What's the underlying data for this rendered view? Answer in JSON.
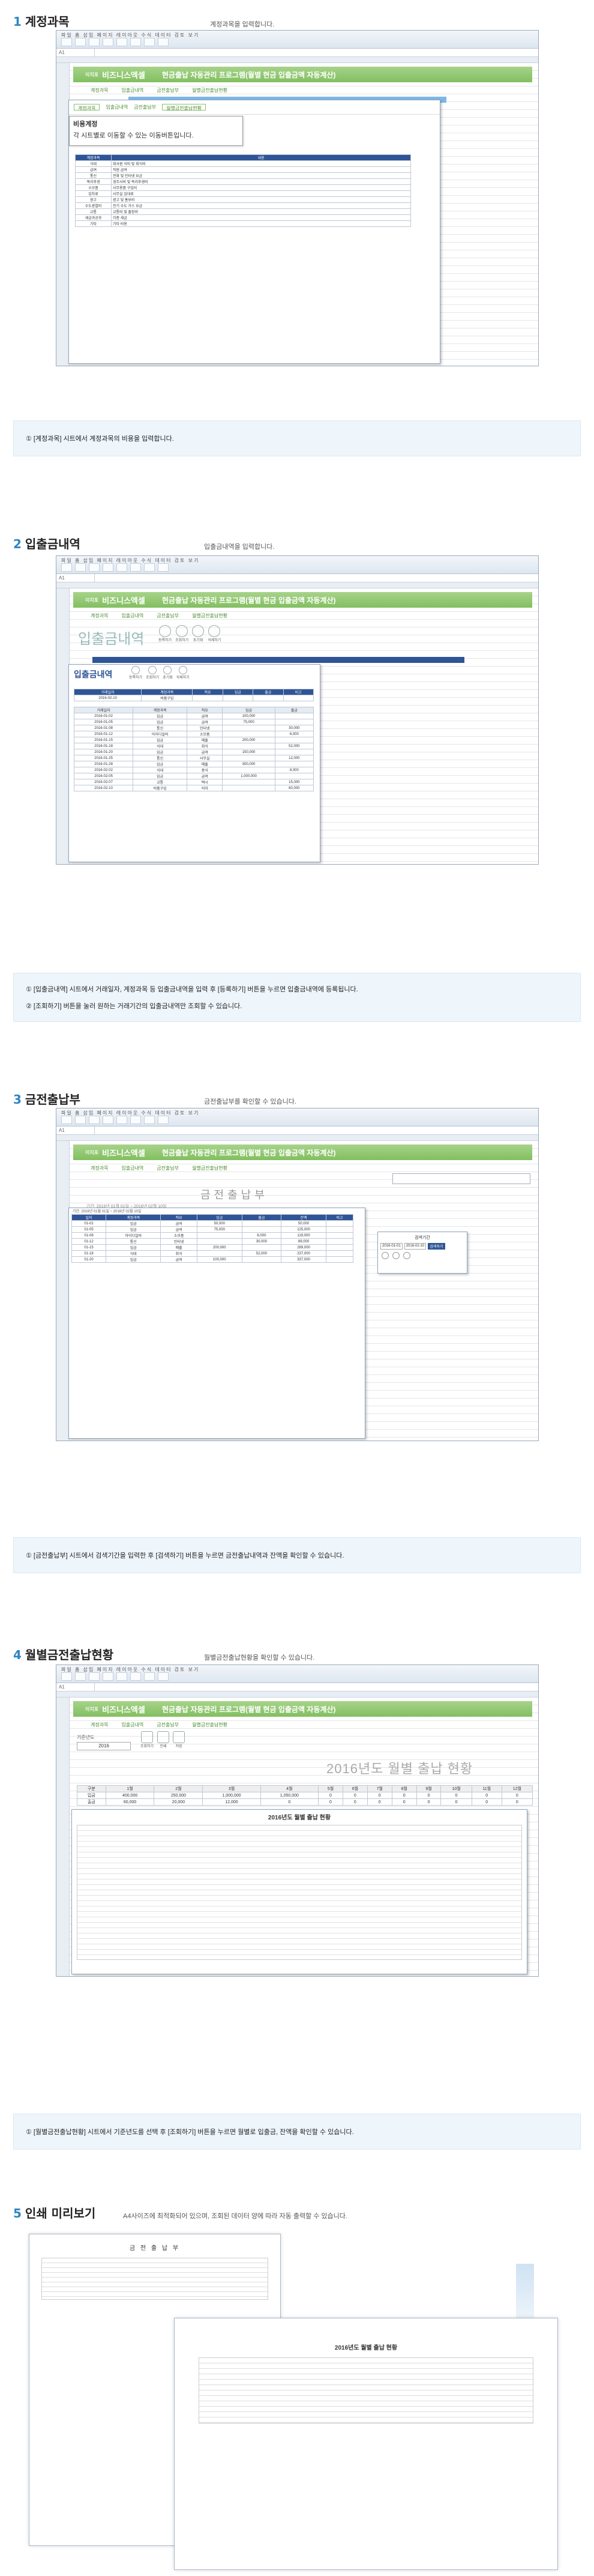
{
  "sections": [
    {
      "num": "1",
      "title": "계정과목",
      "caption": "계정과목을 입력합니다.",
      "note": [
        "① [계정과목] 시트에서 계정과목의 비용을 입력합니다."
      ]
    },
    {
      "num": "2",
      "title": "입출금내역",
      "caption": "입출금내역을 입력합니다.",
      "note": [
        "① [입출금내역] 시트에서 거래일자, 계정과목 등 입출금내역을 입력 후 [등록하기] 버튼을 누르면 입출금내역에 등록됩니다.",
        "② [조회하기] 버튼을 눌러 원하는 거래기간의 입출금내역만 조회할 수 있습니다."
      ]
    },
    {
      "num": "3",
      "title": "금전출납부",
      "caption": "금전출납부를 확인할 수 있습니다.",
      "note": [
        "① [금전출납부] 시트에서 검색기간을 입력한 후 [검색하기] 버튼을 누르면 금전출납내역과 잔액을 확인할 수 있습니다."
      ]
    },
    {
      "num": "4",
      "title": "월별금전출납현황",
      "caption": "월별금전출납현황을 확인할 수 있습니다.",
      "note": [
        "① [월별금전출납현황] 시트에서 기준년도를 선택 후 [조회하기] 버튼을 누르면 월별로 입출금, 잔액을 확인할 수 있습니다."
      ]
    },
    {
      "num": "5",
      "title": "인쇄 미리보기",
      "caption": "A4사이즈에 최적화되어 있으며, 조회된 데이터 양에 따라 자동 출력할 수 있습니다."
    }
  ],
  "app": {
    "logo": "이지포",
    "brand": "비즈니스엑셀",
    "title": "현금출납 자동관리 프로그램(월별 현금 입출금액 자동계산)",
    "cell_ref": "A1",
    "nav": [
      "계정과목",
      "입출금내역",
      "금전출납부",
      "월별금전출납현황"
    ]
  },
  "s1": {
    "popup_title": "비용계정",
    "popup_desc": "각 시트별로 이동할 수 있는 이동버튼입니다.",
    "table_head": [
      "계정과목",
      "내용"
    ],
    "rows": [
      [
        "식대",
        "회사원 식비 및 회식비"
      ],
      [
        "급여",
        "직원 급여"
      ],
      [
        "통신",
        "전화 및 인터넷 요금"
      ],
      [
        "복리후생",
        "경조사비 및 복리후생비"
      ],
      [
        "소모품",
        "사무용품 구입비"
      ],
      [
        "임차료",
        "사무실 임대료"
      ],
      [
        "광고",
        "광고 및 홍보비"
      ],
      [
        "수도광열비",
        "전기 수도 가스 요금"
      ],
      [
        "교통",
        "교통비 및 출장비"
      ],
      [
        "세금과공과",
        "각종 세금"
      ],
      [
        "기타",
        "기타 비용"
      ]
    ]
  },
  "s2": {
    "heading": "입출금내역",
    "buttons": [
      "등록하기",
      "조회하기",
      "초기화",
      "삭제하기"
    ],
    "col_head": [
      "거래일자",
      "계정과목",
      "적요",
      "입금",
      "출금",
      "비고"
    ],
    "input_date": "2016-02-10",
    "input_account": "비품구입",
    "rows": [
      [
        "2016-01-02",
        "입금",
        "급여",
        "100,000",
        ""
      ],
      [
        "2016-01-05",
        "입금",
        "급여",
        "75,000",
        ""
      ],
      [
        "2016-01-08",
        "통신",
        "인터넷",
        "",
        "30,000"
      ],
      [
        "2016-01-12",
        "아이디얼비",
        "소모품",
        "",
        "6,000"
      ],
      [
        "2016-01-15",
        "입금",
        "매출",
        "200,000",
        ""
      ],
      [
        "2016-01-18",
        "식대",
        "회식",
        "",
        "52,000"
      ],
      [
        "2016-01-20",
        "입금",
        "급여",
        "150,000",
        ""
      ],
      [
        "2016-01-25",
        "통신",
        "사무실",
        "",
        "12,000"
      ],
      [
        "2016-01-28",
        "입금",
        "매출",
        "300,000",
        ""
      ],
      [
        "2016-02-02",
        "식대",
        "중식",
        "",
        "8,000"
      ],
      [
        "2016-02-05",
        "입금",
        "급여",
        "1,000,000",
        ""
      ],
      [
        "2016-02-07",
        "교통",
        "택시",
        "",
        "15,000"
      ],
      [
        "2016-02-10",
        "비품구입",
        "의자",
        "",
        "60,000"
      ]
    ]
  },
  "s3": {
    "heading": "금전출납부",
    "period_label": "기간: 2016년 01월 01일 ~ 2016년 02월 10일",
    "search_label": "검색기간",
    "search_from": "2016-01-01",
    "search_to": "2016-02-10",
    "search_btn": "검색하기",
    "col_head": [
      "일자",
      "계정과목",
      "적요",
      "입금",
      "출금",
      "잔액",
      "비고"
    ],
    "rows": [
      [
        "01-02",
        "입금",
        "급여",
        "50,000",
        "",
        "50,000"
      ],
      [
        "01-05",
        "입금",
        "급여",
        "75,000",
        "",
        "125,000"
      ],
      [
        "01-08",
        "아이디얼비",
        "소모품",
        "",
        "6,000",
        "119,000"
      ],
      [
        "01-12",
        "통신",
        "인터넷",
        "",
        "30,000",
        "89,000"
      ],
      [
        "01-15",
        "입금",
        "매출",
        "200,000",
        "",
        "289,000"
      ],
      [
        "01-18",
        "식대",
        "회식",
        "",
        "52,000",
        "237,000"
      ],
      [
        "01-20",
        "입금",
        "급여",
        "100,000",
        "",
        "337,000"
      ]
    ]
  },
  "s4": {
    "heading": "2016년도 월별 출납 현황",
    "year_label": "기준년도",
    "year": "2016",
    "buttons": [
      "조회하기",
      "인쇄",
      "저장"
    ],
    "months": [
      "1월",
      "2월",
      "3월",
      "4월",
      "5월",
      "6월",
      "7월",
      "8월",
      "9월",
      "10월",
      "11월",
      "12월"
    ],
    "summary": [
      [
        "입금",
        "400,000",
        "250,000",
        "1,000,000",
        "1,050,000",
        "0",
        "0",
        "0",
        "0",
        "0",
        "0",
        "0",
        "0"
      ],
      [
        "출금",
        "60,000",
        "20,000",
        "12,000",
        "0",
        "0",
        "0",
        "0",
        "0",
        "0",
        "0",
        "0",
        "0"
      ]
    ],
    "popup_title": "2016년도 월별 출납 현황"
  },
  "s5": {
    "paper1_title": "금 전 출 납 부",
    "paper2_title": "2016년도 월별 출납 현황"
  }
}
